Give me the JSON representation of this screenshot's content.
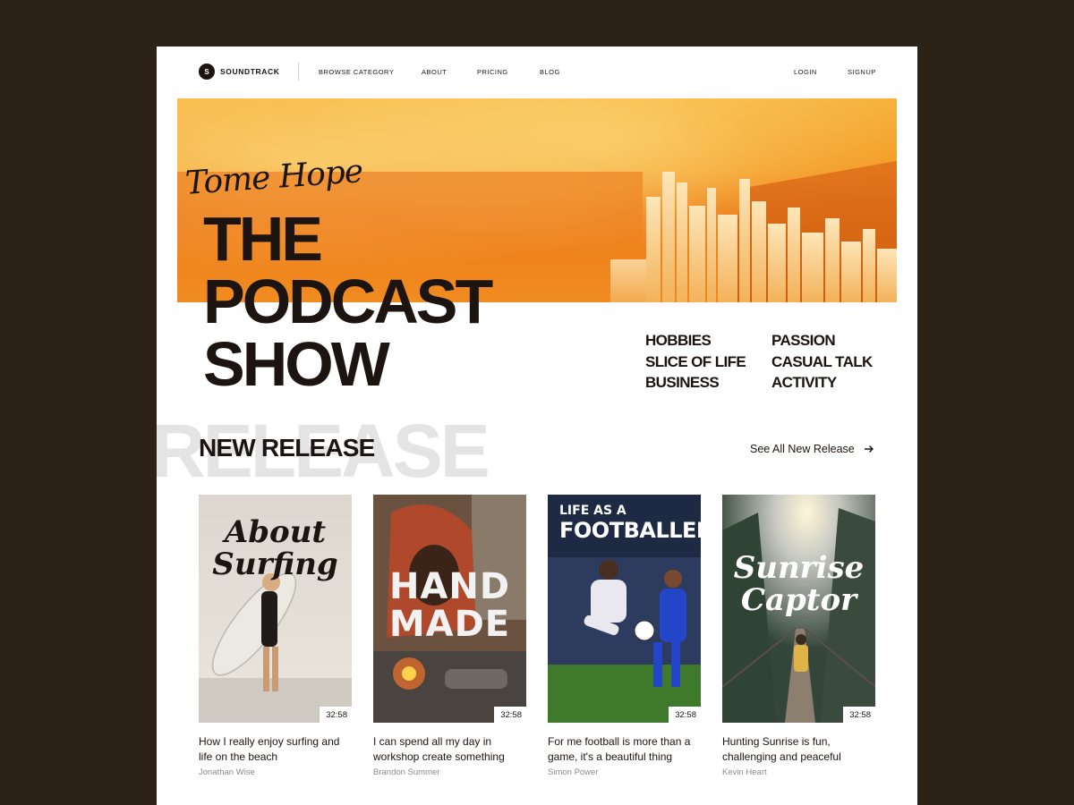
{
  "nav": {
    "brand_initial": "S",
    "brand_name": "SOUNDTRACK",
    "links": [
      "BROWSE CATEGORY",
      "ABOUT",
      "PRICING",
      "BLOG"
    ],
    "login": "LOGIN",
    "signup": "SIGNUP"
  },
  "hero": {
    "script_text": "Tome Hope",
    "title_lines": [
      "THE",
      "PODCAST",
      "SHOW"
    ],
    "categories": [
      "HOBBIES",
      "PASSION",
      "SLICE OF LIFE",
      "CASUAL TALK",
      "BUSINESS",
      "ACTIVITY"
    ]
  },
  "release": {
    "background_text": "RELEASE",
    "title": "NEW RELEASE",
    "see_all": "See All New Release"
  },
  "cards": [
    {
      "thumb_text": [
        "About",
        "Surfing"
      ],
      "duration": "32:58",
      "description": "How I really enjoy surfing and life on the beach",
      "author": "Jonathan Wise"
    },
    {
      "thumb_text": [
        "HAND",
        "MADE"
      ],
      "duration": "32:58",
      "description": "I can spend all my day in workshop create something",
      "author": "Brandon Summer"
    },
    {
      "thumb_text": [
        "LIFE AS A",
        "FOOTBALLER"
      ],
      "duration": "32:58",
      "description": "For me football is more than a game, it's a beautiful thing",
      "author": "Simon Power"
    },
    {
      "thumb_text": [
        "Sunrise",
        "Captor"
      ],
      "duration": "32:58",
      "description": "Hunting Sunrise is fun, challenging and peaceful",
      "author": "Kevin Heart"
    }
  ],
  "colors": {
    "outer_background": "#2c2218",
    "text_dark": "#1c1410",
    "hero_orange": "#f39a25",
    "muted_text": "#8a8a8a",
    "release_watermark": "#e4e4e4"
  },
  "icons": [
    "arrow-right-icon"
  ]
}
